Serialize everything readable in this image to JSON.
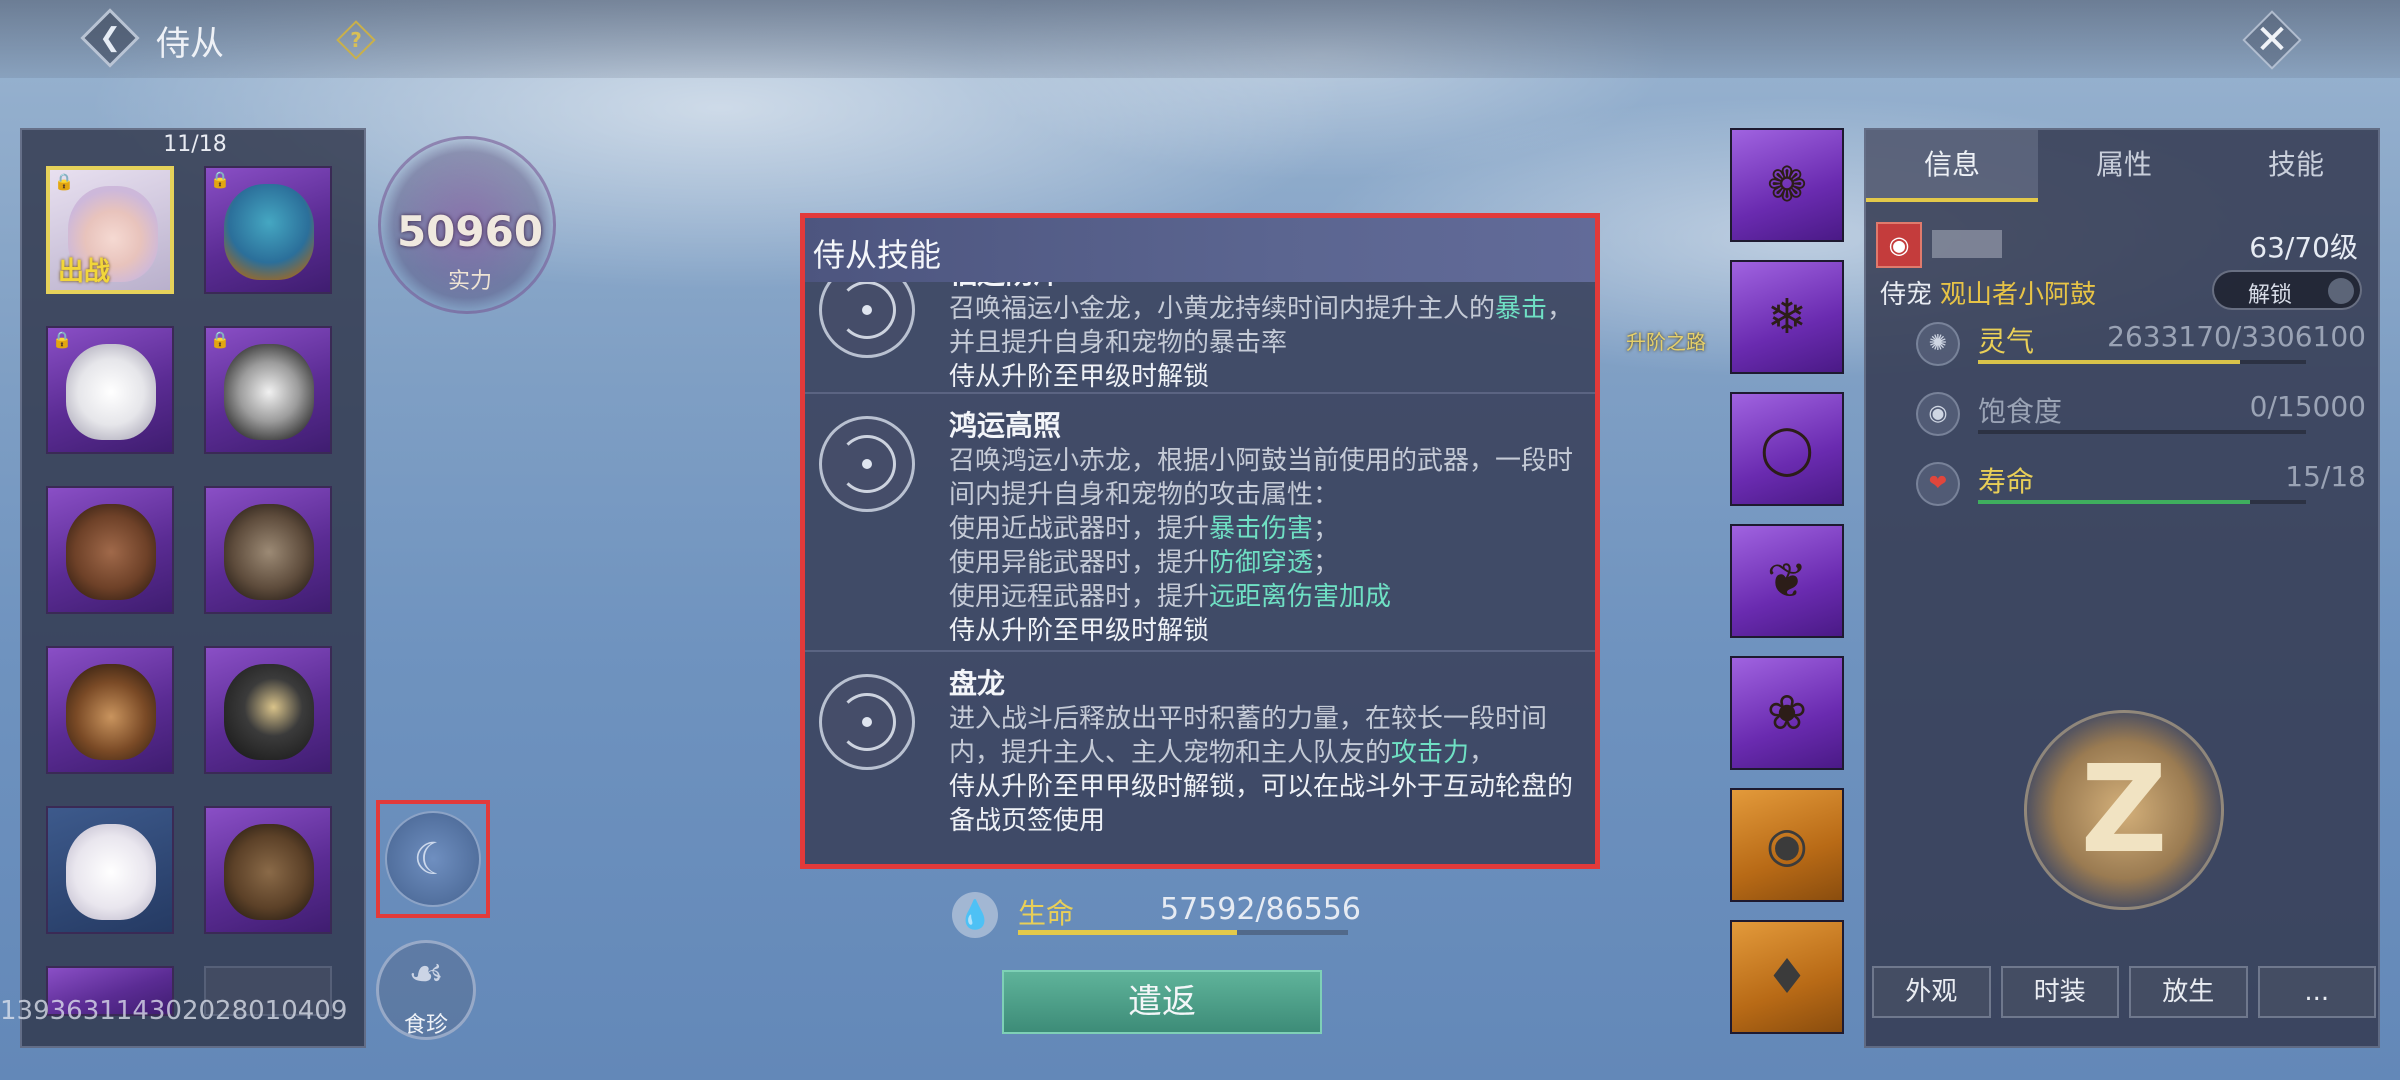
{
  "header": {
    "title": "侍从",
    "help_glyph": "?"
  },
  "pet_list": {
    "count": "11/18",
    "deploy_tag": "出战",
    "slots": [
      {
        "icon": "girl-avatar-icon",
        "locked": true,
        "active": true
      },
      {
        "icon": "bird-avatar-icon",
        "locked": true
      },
      {
        "icon": "wolf-avatar-icon",
        "locked": true
      },
      {
        "icon": "raccoon-avatar-icon",
        "locked": true
      },
      {
        "icon": "dog-avatar-icon"
      },
      {
        "icon": "bull-avatar-icon"
      },
      {
        "icon": "bear-avatar-icon"
      },
      {
        "icon": "eagle-avatar-icon"
      },
      {
        "icon": "sheep-avatar-icon"
      },
      {
        "icon": "capybara-avatar-icon"
      }
    ],
    "uid": "1393631143020280104​09"
  },
  "power": {
    "value": "50960",
    "label": "实力"
  },
  "side_buttons": {
    "food_label": "食珍"
  },
  "behind_modal": {
    "hp_label": "生命",
    "hp_value": "57592/86556",
    "hp_fraction": 0.665,
    "dismiss_label": "遣返",
    "ascend_label": "升阶之路"
  },
  "info_panel": {
    "tabs": [
      "信息",
      "属性",
      "技能"
    ],
    "active_tab": "信息",
    "level": "63/70级",
    "pet_type_label": "侍宠",
    "pet_type_name": "观山者小阿鼓",
    "unlock_label": "解锁",
    "stats": [
      {
        "label": "灵气",
        "value": "2633170/3306100",
        "fraction": 0.8,
        "color": "#d9c34a",
        "label_color": "#e9cf57",
        "icon": "swirl-icon"
      },
      {
        "label": "饱食度",
        "value": "0/15000",
        "fraction": 0.0,
        "color": "#7a8295",
        "label_color": "#9aa3b5",
        "icon": "stomach-icon"
      },
      {
        "label": "寿命",
        "value": "15/18",
        "fraction": 0.83,
        "color": "#3fae5e",
        "label_color": "#e9cf57",
        "icon": "heart-icon"
      }
    ],
    "buttons": [
      "外观",
      "时装",
      "放生",
      "..."
    ]
  },
  "modal": {
    "title": "侍从技能",
    "skills": [
      {
        "name": "福运荫泽",
        "desc_parts": [
          {
            "t": "召唤福运小金龙，小黄龙持续时间内提升主人的"
          },
          {
            "t": "暴击",
            "hl": true
          },
          {
            "t": "，并且提升自身和宠物的暴击率"
          }
        ],
        "lock_note": "侍从升阶至甲级时解锁"
      },
      {
        "name": "鸿运高照",
        "desc_parts": [
          {
            "t": "召唤鸿运小赤龙，根据小阿鼓当前使用的武器，一段时间内提升自身和宠物的攻击属性："
          },
          {
            "t": "使用近战武器时，提升",
            "br": true
          },
          {
            "t": "暴击伤害",
            "hl": true
          },
          {
            "t": "；"
          },
          {
            "t": "使用异能武器时，提升",
            "br": true
          },
          {
            "t": "防御穿透",
            "hl": true
          },
          {
            "t": "；"
          },
          {
            "t": "使用远程武器时，提升",
            "br": true
          },
          {
            "t": "远距离伤害加成",
            "hl": true
          }
        ],
        "lock_note": "侍从升阶至甲级时解锁"
      },
      {
        "name": "盘龙",
        "desc_parts": [
          {
            "t": "进入战斗后释放出平时积蓄的力量，在较长一段时间内，提升主人、主人宠物和主人队友的"
          },
          {
            "t": "攻击力",
            "hl": true
          },
          {
            "t": "，"
          }
        ],
        "lock_note": "侍从升阶至甲甲级时解锁，可以在战斗外于互动轮盘的备战页签使用"
      }
    ]
  }
}
